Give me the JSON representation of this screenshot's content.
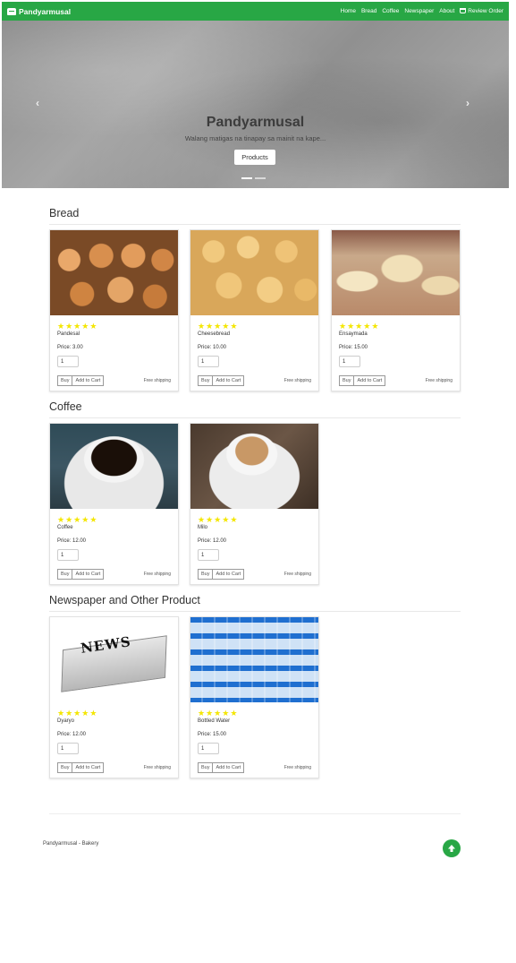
{
  "nav": {
    "brand": "Pandyarmusal",
    "links": [
      "Home",
      "Bread",
      "Coffee",
      "Newspaper",
      "About"
    ],
    "review_order": "Review Order"
  },
  "hero": {
    "title": "Pandyarmusal",
    "subtitle": "Walang matigas na tinapay sa mainit na kape...",
    "button": "Products",
    "prev": "‹",
    "next": "›"
  },
  "sections": [
    {
      "title": "Bread",
      "products": [
        {
          "name": "Pandesal",
          "price": "Price: 3.00",
          "qty": "1",
          "image": "pandesal-photo",
          "stars": 5
        },
        {
          "name": "Cheesebread",
          "price": "Price: 10.00",
          "qty": "1",
          "image": "cheesebread-photo",
          "stars": 5
        },
        {
          "name": "Ensaymada",
          "price": "Price: 15.00",
          "qty": "1",
          "image": "ensaymada-photo",
          "stars": 5
        }
      ]
    },
    {
      "title": "Coffee",
      "products": [
        {
          "name": "Coffee",
          "price": "Price: 12.00",
          "qty": "1",
          "image": "coffee-cup-photo",
          "stars": 5
        },
        {
          "name": "Milo",
          "price": "Price: 12.00",
          "qty": "1",
          "image": "milo-cup-photo",
          "stars": 5
        }
      ]
    },
    {
      "title": "Newspaper and Other Product",
      "products": [
        {
          "name": "Dyaryo",
          "price": "Price: 12.00",
          "qty": "1",
          "image": "newspaper-photo",
          "stars": 5
        },
        {
          "name": "Bottled Water",
          "price": "Price: 15.00",
          "qty": "1",
          "image": "bottled-water-photo",
          "stars": 5
        }
      ]
    }
  ],
  "card_labels": {
    "buy": "Buy",
    "add_to_cart": "Add to Cart",
    "shipping": "Free shipping"
  },
  "footer": {
    "text": "Pandyarmusal - Bakery"
  },
  "colors": {
    "brand_green": "#28a745",
    "star_yellow": "#f4e600"
  }
}
